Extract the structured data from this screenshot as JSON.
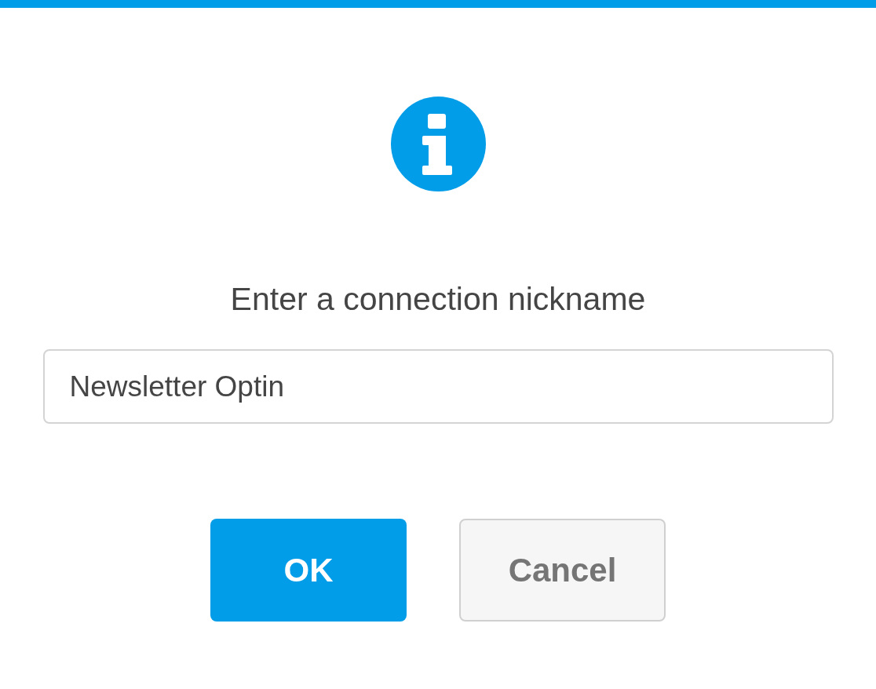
{
  "dialog": {
    "message": "Enter a connection nickname",
    "input": {
      "value": "Newsletter Optin"
    },
    "buttons": [
      {
        "label": "OK",
        "kind": "primary"
      },
      {
        "label": "Cancel",
        "kind": "secondary"
      }
    ]
  }
}
